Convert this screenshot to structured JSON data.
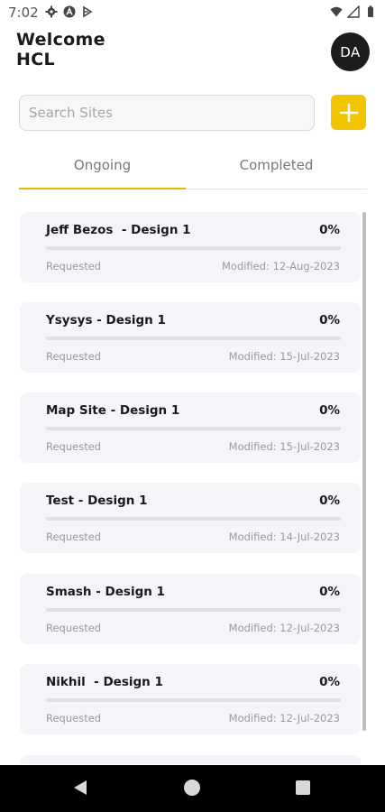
{
  "status_bar": {
    "time": "7:02",
    "left_icons": [
      "gear-icon",
      "a-icon",
      "play-protect-icon"
    ],
    "right_icons": [
      "wifi-icon",
      "signal-icon",
      "battery-icon"
    ]
  },
  "header": {
    "welcome_line1": "Welcome",
    "welcome_line2": "HCL",
    "avatar_initials": "DA"
  },
  "search": {
    "placeholder": "Search Sites",
    "value": ""
  },
  "add_button": {
    "icon": "plus-icon"
  },
  "tabs": [
    {
      "label": "Ongoing",
      "active": true
    },
    {
      "label": "Completed",
      "active": false
    }
  ],
  "colors": {
    "accent": "#F2C500",
    "tab_indicator": "#E6B800",
    "card_bg": "#F4F5F8"
  },
  "sites": [
    {
      "title": "Jeff Bezos  - Design 1",
      "percent": "0%",
      "progress": 0,
      "status": "Requested",
      "modified": "Modified: 12-Aug-2023"
    },
    {
      "title": "Ysysys - Design 1",
      "percent": "0%",
      "progress": 0,
      "status": "Requested",
      "modified": "Modified: 15-Jul-2023"
    },
    {
      "title": "Map Site - Design 1",
      "percent": "0%",
      "progress": 0,
      "status": "Requested",
      "modified": "Modified: 15-Jul-2023"
    },
    {
      "title": "Test - Design 1",
      "percent": "0%",
      "progress": 0,
      "status": "Requested",
      "modified": "Modified: 14-Jul-2023"
    },
    {
      "title": "Smash - Design 1",
      "percent": "0%",
      "progress": 0,
      "status": "Requested",
      "modified": "Modified: 12-Jul-2023"
    },
    {
      "title": "Nikhil  - Design 1",
      "percent": "0%",
      "progress": 0,
      "status": "Requested",
      "modified": "Modified: 12-Jul-2023"
    }
  ],
  "nav_bar": {
    "buttons": [
      "back-icon",
      "home-icon",
      "recents-icon"
    ]
  }
}
